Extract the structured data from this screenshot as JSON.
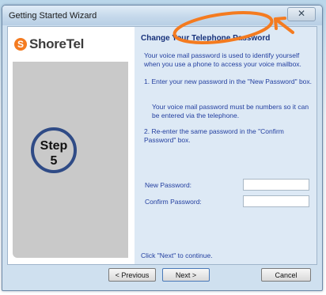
{
  "window": {
    "title": "Getting Started Wizard",
    "close_glyph": "✕"
  },
  "logo": {
    "mark": "S",
    "text": "ShoreTel"
  },
  "step": {
    "label": "Step",
    "number": "5"
  },
  "content": {
    "heading": "Change Your Telephone Password",
    "para1": "Your voice mail password is used to identify yourself when you use a phone to access your voice mailbox.",
    "para2": "1. Enter your new password in the \"New Password\" box.",
    "para3": "Your voice mail password must be numbers so it can be entered via the telephone.",
    "para4": "2. Re-enter the same password in the \"Confirm Password\" box.",
    "new_password_label": "New Password:",
    "confirm_password_label": "Confirm Password:",
    "new_password_value": "",
    "confirm_password_value": "",
    "footer_text": "Click \"Next\" to continue."
  },
  "buttons": {
    "previous": "< Previous",
    "next": "Next >",
    "cancel": "Cancel"
  },
  "colors": {
    "annotation": "#f47b20",
    "step_ring": "#2f4b86",
    "text_blue": "#2440a0"
  }
}
